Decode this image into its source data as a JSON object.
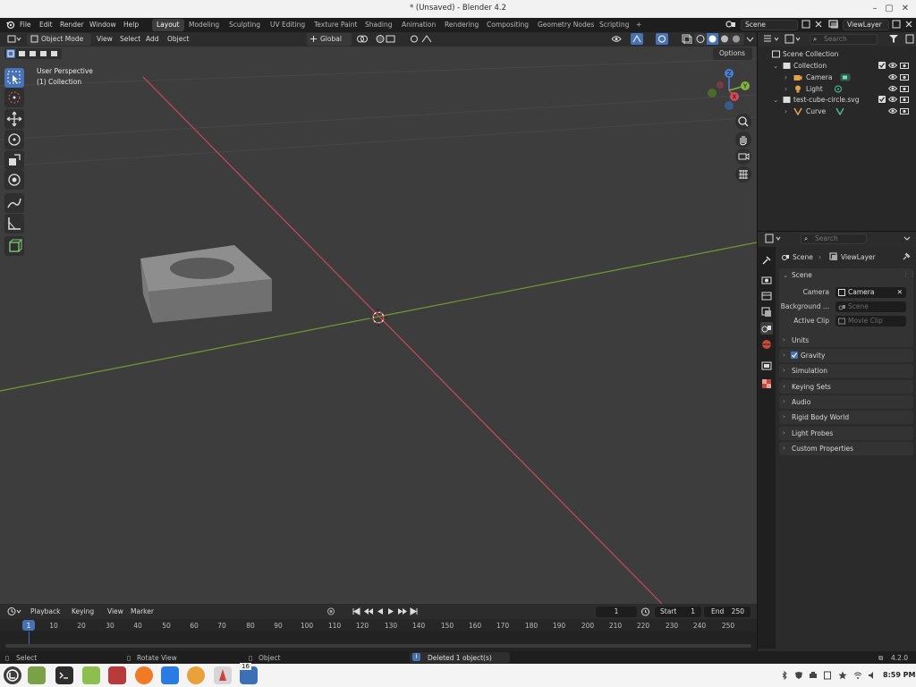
{
  "window": {
    "title": "* (Unsaved) - Blender 4.2"
  },
  "menubar": {
    "menus": [
      "File",
      "Edit",
      "Render",
      "Window",
      "Help"
    ],
    "workspaces": [
      "Layout",
      "Modeling",
      "Sculpting",
      "UV Editing",
      "Texture Paint",
      "Shading",
      "Animation",
      "Rendering",
      "Compositing",
      "Geometry Nodes",
      "Scripting"
    ],
    "active_workspace": "Layout",
    "add_workspace": "+",
    "scene": "Scene",
    "view_layer": "ViewLayer"
  },
  "viewport_header": {
    "mode": "Object Mode",
    "menus": [
      "View",
      "Select",
      "Add",
      "Object"
    ],
    "orientation": "Global",
    "options": "Options"
  },
  "viewport": {
    "overlay_line1": "User Perspective",
    "overlay_line2": "(1) Collection",
    "gizmo_x": "X",
    "gizmo_y": "Y",
    "gizmo_z": "Z",
    "colors": {
      "x_axis": "#c74a5a",
      "y_axis": "#6f9a2e",
      "background": "#3d3d3d",
      "accent": "#4772b3"
    }
  },
  "outliner": {
    "search_placeholder": "Search",
    "root": "Scene Collection",
    "items": [
      {
        "label": "Collection",
        "icon": "collection-icon"
      },
      {
        "label": "Camera",
        "icon": "camera-icon"
      },
      {
        "label": "Light",
        "icon": "light-icon"
      },
      {
        "label": "test-cube-circle.svg",
        "icon": "collection-icon"
      },
      {
        "label": "Curve",
        "icon": "curve-icon"
      }
    ]
  },
  "properties": {
    "search_placeholder": "Search",
    "breadcrumb": [
      "Scene",
      "ViewLayer"
    ],
    "scene_panel": "Scene",
    "camera_label": "Camera",
    "camera_value": "Camera",
    "background_label": "Background ...",
    "background_placeholder": "Scene",
    "clip_label": "Active Clip",
    "clip_placeholder": "Movie Clip",
    "panels": [
      "Units",
      "Gravity",
      "Simulation",
      "Keying Sets",
      "Audio",
      "Rigid Body World",
      "Light Probes",
      "Custom Properties"
    ],
    "gravity_checked": true
  },
  "timeline": {
    "menus": [
      "Playback",
      "Keying",
      "View",
      "Marker"
    ],
    "current_frame": "1",
    "start_label": "Start",
    "start_value": "1",
    "end_label": "End",
    "end_value": "250",
    "ruler": [
      "1",
      "10",
      "20",
      "30",
      "40",
      "50",
      "60",
      "70",
      "80",
      "90",
      "100",
      "110",
      "120",
      "130",
      "140",
      "150",
      "160",
      "170",
      "180",
      "190",
      "200",
      "210",
      "220",
      "230",
      "240",
      "250"
    ]
  },
  "statusbar": {
    "select": "Select",
    "rotate": "Rotate View",
    "object": "Object",
    "message": "Deleted 1 object(s)",
    "version": "4.2.0"
  },
  "taskbar": {
    "clock": "8:59 PM",
    "badge": "16"
  }
}
